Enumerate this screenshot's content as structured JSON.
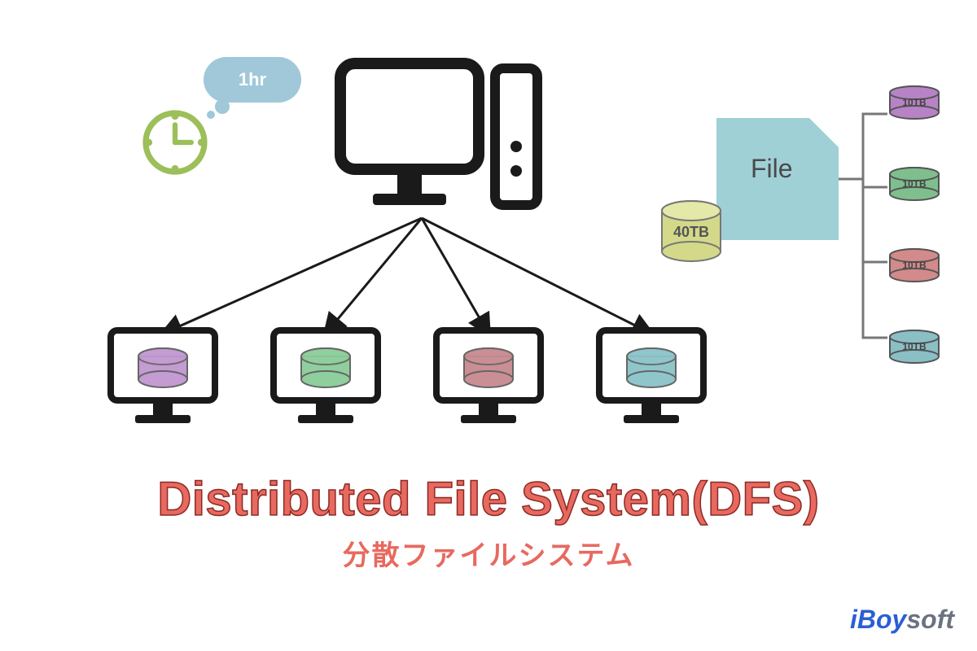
{
  "bubble": {
    "label": "1hr"
  },
  "file": {
    "label": "File"
  },
  "source_disk": {
    "label": "40TB"
  },
  "storage_nodes": [
    {
      "label": "10TB",
      "color": "#b783c6"
    },
    {
      "label": "10TB",
      "color": "#7fbf8e"
    },
    {
      "label": "10TB",
      "color": "#d38a8a"
    },
    {
      "label": "10TB",
      "color": "#8abfc6"
    }
  ],
  "clients": [
    {
      "color": "#c49bd2"
    },
    {
      "color": "#8fcf9d"
    },
    {
      "color": "#c98f94"
    },
    {
      "color": "#8fc6cc"
    }
  ],
  "title": {
    "main": "Distributed File System(DFS)",
    "sub": "分散ファイルシステム"
  },
  "brand": {
    "name_i": "iBoy",
    "name_soft": "soft"
  }
}
